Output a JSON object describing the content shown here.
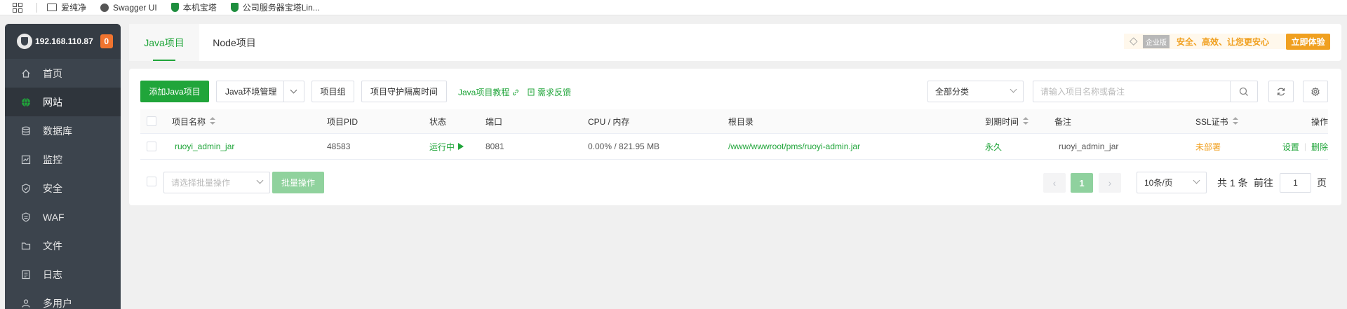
{
  "bookmarks": [
    {
      "icon": "folder-icon",
      "label": "爱纯净"
    },
    {
      "icon": "globe-icon",
      "label": "Swagger UI"
    },
    {
      "icon": "shield-icon",
      "label": "本机宝塔"
    },
    {
      "icon": "shield-icon",
      "label": "公司服务器宝塔Lin..."
    }
  ],
  "sidebar": {
    "ip": "192.168.110.87",
    "badge": "0",
    "items": [
      {
        "label": "首页",
        "icon": "home-icon"
      },
      {
        "label": "网站",
        "icon": "globe-icon",
        "active": true
      },
      {
        "label": "数据库",
        "icon": "database-icon"
      },
      {
        "label": "监控",
        "icon": "monitor-icon"
      },
      {
        "label": "安全",
        "icon": "security-shield-icon"
      },
      {
        "label": "WAF",
        "icon": "waf-shield-icon"
      },
      {
        "label": "文件",
        "icon": "folder-icon"
      },
      {
        "label": "日志",
        "icon": "log-icon"
      },
      {
        "label": "多用户",
        "icon": "users-icon"
      }
    ]
  },
  "tabs": [
    {
      "label": "Java项目",
      "active": true
    },
    {
      "label": "Node项目"
    }
  ],
  "enterprise": {
    "tag": "企业版",
    "slogan": "安全、高效、让您更安心",
    "try_label": "立即体验"
  },
  "toolbar": {
    "add_label": "添加Java项目",
    "env_label": "Java环境管理",
    "group_label": "项目组",
    "guard_label": "项目守护隔离时间",
    "tutorial_label": "Java项目教程",
    "feedback_label": "需求反馈",
    "category_value": "全部分类",
    "search_placeholder": "请输入项目名称或备注"
  },
  "table": {
    "headers": {
      "name": "项目名称",
      "pid": "项目PID",
      "status": "状态",
      "port": "端口",
      "cpu_mem": "CPU / 内存",
      "root": "根目录",
      "expire": "到期时间",
      "remark": "备注",
      "ssl": "SSL证书",
      "ops": "操作"
    },
    "rows": [
      {
        "name": "ruoyi_admin_jar",
        "pid": "48583",
        "status": "运行中",
        "port": "8081",
        "cpu_mem": "0.00% / 821.95 MB",
        "root": "/www/wwwroot/pms/ruoyi-admin.jar",
        "expire": "永久",
        "remark": "ruoyi_admin_jar",
        "ssl": "未部署",
        "op_settings": "设置",
        "op_sep": "|",
        "op_delete": "删除"
      }
    ]
  },
  "footer": {
    "batch_placeholder": "请选择批量操作",
    "batch_button": "批量操作",
    "current_page": "1",
    "page_size": "10条/页",
    "total_text": "共 1 条",
    "goto_text": "前往",
    "goto_value": "1",
    "page_suffix": "页"
  },
  "colors": {
    "accent": "#20a53a",
    "sidebar_bg": "#3c444d",
    "badge": "#f0742f",
    "warning": "#f0a020"
  }
}
